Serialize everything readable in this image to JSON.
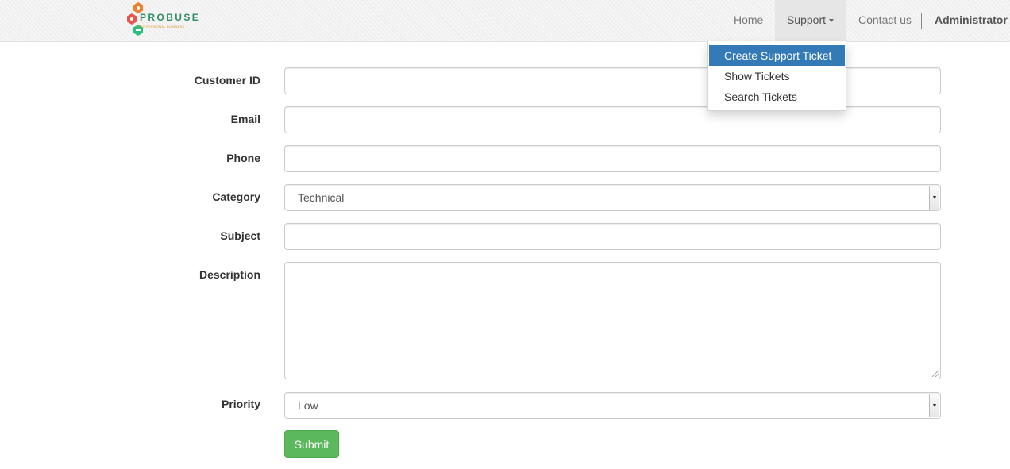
{
  "brand": {
    "name": "PROBUSE",
    "tagline": "PROFESSIONAL BUSINESS",
    "colors": {
      "orange": "#f07f2b",
      "red": "#e8554f",
      "green": "#2ebd7e"
    }
  },
  "nav": {
    "home": "Home",
    "support": "Support",
    "contact": "Contact us",
    "user": "Administrator"
  },
  "dropdown": {
    "items": [
      "Create Support Ticket",
      "Show Tickets",
      "Search Tickets"
    ],
    "active_index": 0
  },
  "form": {
    "customer_id": {
      "label": "Customer ID",
      "value": ""
    },
    "email": {
      "label": "Email",
      "value": ""
    },
    "phone": {
      "label": "Phone",
      "value": ""
    },
    "category": {
      "label": "Category",
      "value": "Technical"
    },
    "subject": {
      "label": "Subject",
      "value": ""
    },
    "description": {
      "label": "Description",
      "value": ""
    },
    "priority": {
      "label": "Priority",
      "value": "Low"
    },
    "submit_label": "Submit"
  },
  "colors": {
    "accent_blue": "#337ab7",
    "submit_green": "#5cb85c"
  }
}
